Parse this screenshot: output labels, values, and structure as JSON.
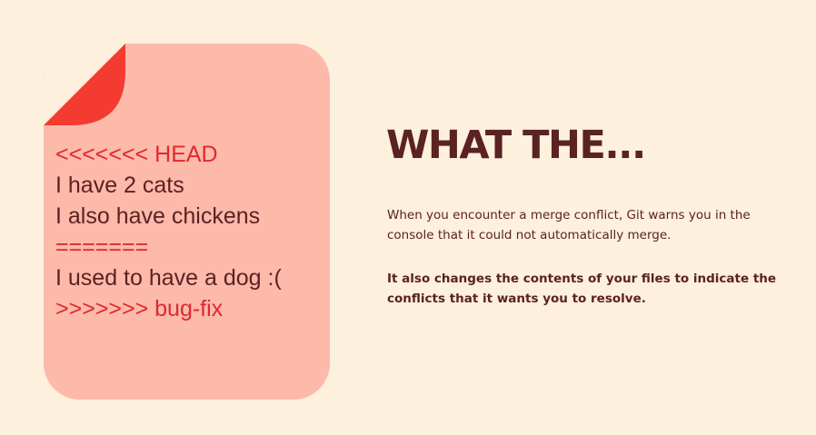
{
  "colors": {
    "background": "#fdf0dd",
    "card": "#fdb9aa",
    "fold": "#f33b32",
    "marker_text": "#de2a2f",
    "body_text": "#5a2222"
  },
  "icons": {
    "card": "document-icon"
  },
  "code_sample": {
    "lines": [
      {
        "text": "<<<<<<< HEAD",
        "kind": "marker"
      },
      {
        "text": "I have 2 cats",
        "kind": "content"
      },
      {
        "text": "I also have chickens",
        "kind": "content"
      },
      {
        "text": "=======",
        "kind": "marker"
      },
      {
        "text": "I used to have a dog :(",
        "kind": "content"
      },
      {
        "text": ">>>>>>> bug-fix",
        "kind": "marker"
      }
    ]
  },
  "headline": "WHAT THE...",
  "paragraphs": [
    "When you encounter a merge conflict, Git warns you in the console that it could not automatically merge.",
    "It also changes the contents of your files to indicate the conflicts that it wants you to resolve."
  ]
}
